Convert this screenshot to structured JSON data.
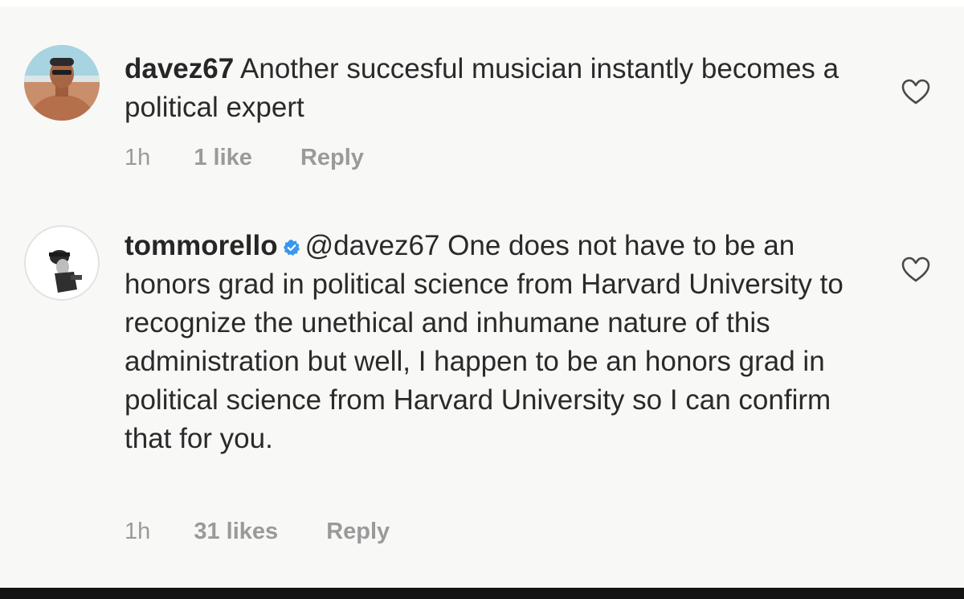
{
  "comments": [
    {
      "username": "davez67",
      "text": " Another succesful musician instantly becomes a political expert",
      "time": "1h",
      "likes": "1 like",
      "reply_label": "Reply",
      "verified": false
    },
    {
      "username": "tommorello",
      "text": "@davez67 One does not have to be an honors grad in political science from Harvard University to recognize the unethical and inhumane nature of this administration but well, I happen to be an honors grad in political science from Harvard University so I can confirm that for you.",
      "time": "1h",
      "likes": "31 likes",
      "reply_label": "Reply",
      "verified": true
    }
  ],
  "icons": {
    "like": "heart-outline-icon",
    "verified": "verified-badge-icon"
  },
  "colors": {
    "text": "#262626",
    "meta": "#9a9a9a",
    "verified": "#3897f0",
    "background": "#f8f8f7"
  }
}
